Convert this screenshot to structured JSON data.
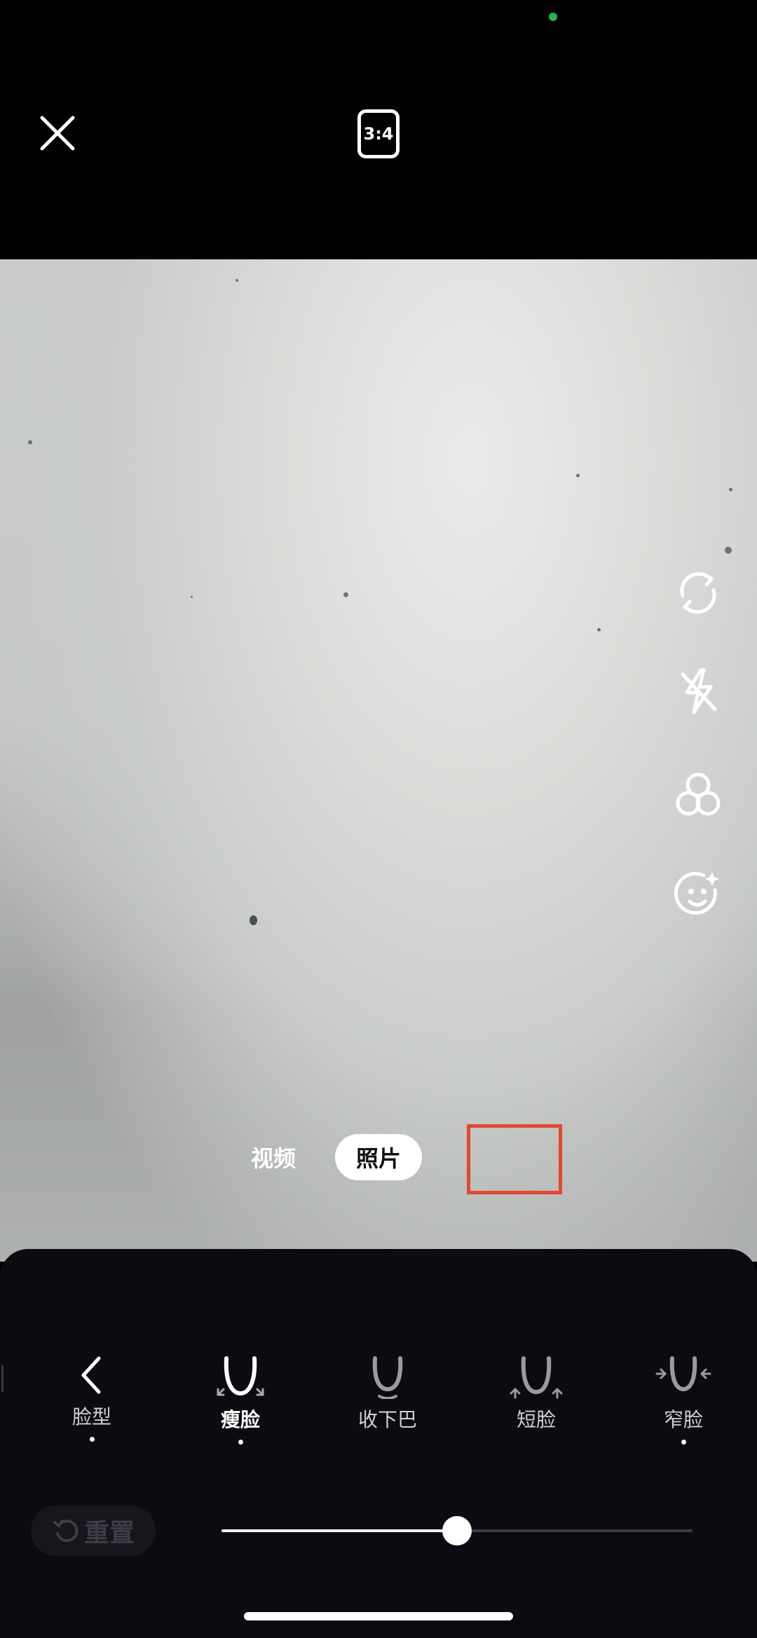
{
  "top_bar": {
    "close_icon": "close-icon",
    "aspect_ratio": "3:4"
  },
  "side_tools": [
    "flip-camera-icon",
    "flash-off-icon",
    "filter-icon",
    "beauty-face-icon"
  ],
  "mode_switch": {
    "video_label": "视频",
    "photo_label": "照片",
    "selected": "照片"
  },
  "face_panel": {
    "back_label": "脸型",
    "options": [
      {
        "label": "瘦脸",
        "active": true
      },
      {
        "label": "收下巴",
        "active": false
      },
      {
        "label": "短脸",
        "active": false
      },
      {
        "label": "窄脸",
        "active": false
      }
    ]
  },
  "reset_label": "重置",
  "slider": {
    "value": 0.5
  },
  "colors": {
    "highlight_box": "#e4472f",
    "panel_bg": "#0c0b12",
    "status_dot": "#2bb14b"
  }
}
